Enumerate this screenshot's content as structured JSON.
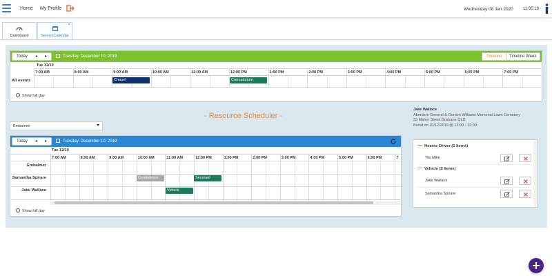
{
  "topbar": {
    "nav_home": "Home",
    "nav_profile": "My Profile",
    "date": "Wednesday 08 Jan 2020",
    "time": "11:35:16",
    "info_icon": "info-icon",
    "logout_icon": "logout-icon"
  },
  "tabs": [
    {
      "label": "Dashboard",
      "icon": "gauge-icon"
    },
    {
      "label": "ServiceCalendar",
      "icon": "calendar-icon",
      "close": "×"
    }
  ],
  "page_title": "- Resource Scheduler -",
  "service_calendar": {
    "today_label": "Today",
    "prev": "◂",
    "next": "▸",
    "date_label": "Tuesday, December 10, 2019",
    "views": [
      "Timeline",
      "Timeline Week"
    ],
    "day_header": "Tue 12/10",
    "hours": [
      "7:00 AM",
      "8:00 AM",
      "9:00 AM",
      "10:00 AM",
      "11:00 AM",
      "12:00 PM",
      "1:00 PM",
      "2:00 PM",
      "3:00 PM",
      "4:00 PM",
      "5:00 PM",
      "6:00 PM",
      "7:00 PM"
    ],
    "row_label": "All events",
    "events": [
      {
        "title": "Chapel",
        "color": "#0f2d6b"
      },
      {
        "title": "Crematorium",
        "color": "#1e7a57"
      }
    ],
    "show_full_day": "Show full day",
    "accent": "#7dc12e"
  },
  "resource_select": {
    "value": "Embalmer"
  },
  "resource_calendar": {
    "today_label": "Today",
    "prev": "◂",
    "next": "▸",
    "date_label": "Tuesday, December 10, 2019",
    "day_header": "Tue 12/10",
    "hours": [
      "7:00 AM",
      "8:00 AM",
      "9:00 AM",
      "10:00 AM",
      "11:00 AM",
      "12:00 PM",
      "1:00 PM",
      "2:00 PM",
      "3:00 PM",
      "4:00 PM",
      "5:00 PM",
      "6:00 PM",
      "7"
    ],
    "resources": [
      "Embalmer",
      "Samantha Spirare",
      "Jake Wallace"
    ],
    "events": [
      {
        "title": "Condolence",
        "color": "#a8a8a8"
      },
      {
        "title": "Seconed",
        "color": "#1e7a57"
      },
      {
        "title": "Vehicle",
        "color": "#1e7a57"
      }
    ],
    "show_full_day": "Show full day",
    "accent": "#2a87d6",
    "refresh_icon": "refresh-icon"
  },
  "booking_info": {
    "name": "Jake Wallace",
    "location": "Aberdare General & Gordon Williams Memorial Lawn Cemetery",
    "address": "33 Maher Street Brisbane QLD",
    "schedule": "Burial on 10/12/2019 @ 12:00 - 13:00"
  },
  "resource_panel": {
    "groups": [
      {
        "title": "Hearse Driver (1 Items)",
        "items": [
          "Tibi Mitin"
        ]
      },
      {
        "title": "Vehicle (2 Items)",
        "items": [
          "Jake Wallace",
          "Samantha Spirare"
        ]
      }
    ],
    "edit_icon": "edit-icon",
    "delete_icon": "delete-icon",
    "accent": "#e08b3a"
  },
  "fab": {
    "icon": "plus-icon"
  }
}
